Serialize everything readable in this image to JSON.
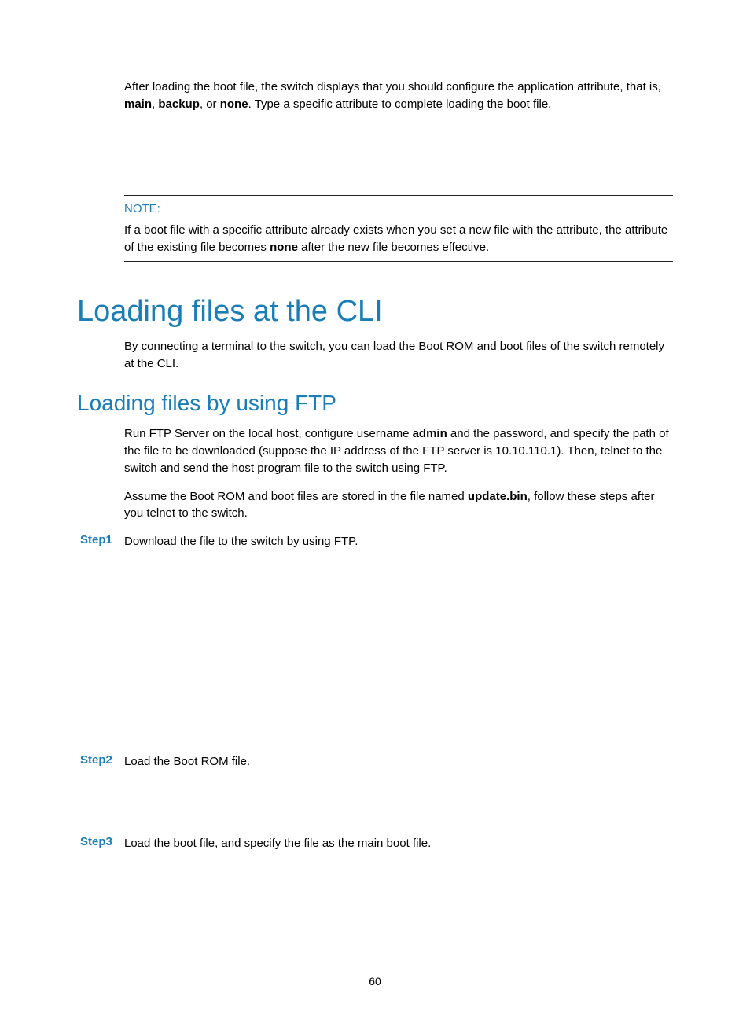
{
  "intro": {
    "line1_pre": "After loading the boot file, the switch displays that you should configure the application attribute, that is, ",
    "b1": "main",
    "sep1": ", ",
    "b2": "backup",
    "sep2": ", or ",
    "b3": "none",
    "line1_post": ". Type a specific attribute to complete loading the boot file."
  },
  "note": {
    "label": "NOTE:",
    "text_pre": "If a boot file with a specific attribute already exists when you set a new file with the attribute, the attribute of the existing file becomes ",
    "bold": "none",
    "text_post": " after the new file becomes effective."
  },
  "h1": "Loading files at the CLI",
  "p_h1": "By connecting a terminal to the switch, you can load the Boot ROM and boot files of the switch remotely at the CLI.",
  "h2": "Loading files by using FTP",
  "p_h2a_pre": "Run FTP Server on the local host, configure username ",
  "p_h2a_b": "admin",
  "p_h2a_post": " and the password, and specify the path of the file to be downloaded (suppose the IP address of the FTP server is 10.10.110.1). Then, telnet to the switch and send the host program file to the switch using FTP.",
  "p_h2b_pre": "Assume the Boot ROM and boot files are stored in the file named ",
  "p_h2b_b": "update.bin",
  "p_h2b_post": ", follow these steps after you telnet to the switch.",
  "steps": {
    "s1_label": "Step1",
    "s1_text": "Download the file to the switch by using FTP.",
    "s2_label": "Step2",
    "s2_text": "Load the Boot ROM file.",
    "s3_label": "Step3",
    "s3_text": "Load the boot file, and specify the file as the main boot file."
  },
  "page_number": "60"
}
